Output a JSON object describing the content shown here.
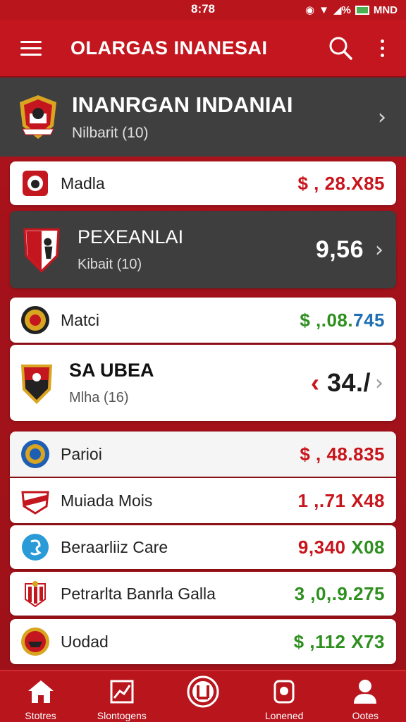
{
  "status_bar": {
    "time": "8:78",
    "carrier": "MND",
    "icons": [
      "signal-icon",
      "wifi-icon",
      "battery-icon"
    ]
  },
  "app_bar": {
    "title": "OLARGAS INANESAI"
  },
  "hero": {
    "title": "INANRGAN INDANIAI",
    "subtitle": "Nilbarit (10)"
  },
  "rows": [
    {
      "name": "Madla",
      "value": "$ , 28.X85",
      "color": "#c8141b"
    },
    {
      "type": "big-dark",
      "title": "PEXEANLAI",
      "subtitle": "Kibait (10)",
      "value": "9,56"
    },
    {
      "name": "Matci",
      "value_main": "$ ,.08.",
      "value_tail": "745"
    },
    {
      "type": "big",
      "title": "SA UBEA",
      "subtitle": "Mlha (16)",
      "value_prefix": "‹",
      "value": "34./"
    },
    {
      "name": "Parioi",
      "value": "$ , 48.835",
      "color": "#c8141b"
    },
    {
      "name": "Muiada Mois",
      "value": "1 ,.71 X48",
      "color": "#c8141b"
    },
    {
      "name": "Beraarliiz Care",
      "value_main": "9,340",
      "value_tail": "X08"
    },
    {
      "name": "Petrarlta Banrla Galla",
      "value": "3 ,0,.9.275",
      "color": "#2e8f1f"
    },
    {
      "name": "Uodad",
      "value": "$ ,112 X73",
      "color": "#2e8f1f"
    }
  ],
  "bottom_nav": [
    {
      "label": "Stotres",
      "icon": "home-icon"
    },
    {
      "label": "Slontogens",
      "icon": "chart-icon"
    },
    {
      "label": "",
      "icon": "club-badge-icon"
    },
    {
      "label": "Lonened",
      "icon": "badge-icon"
    },
    {
      "label": "Ootes",
      "icon": "person-icon"
    }
  ]
}
